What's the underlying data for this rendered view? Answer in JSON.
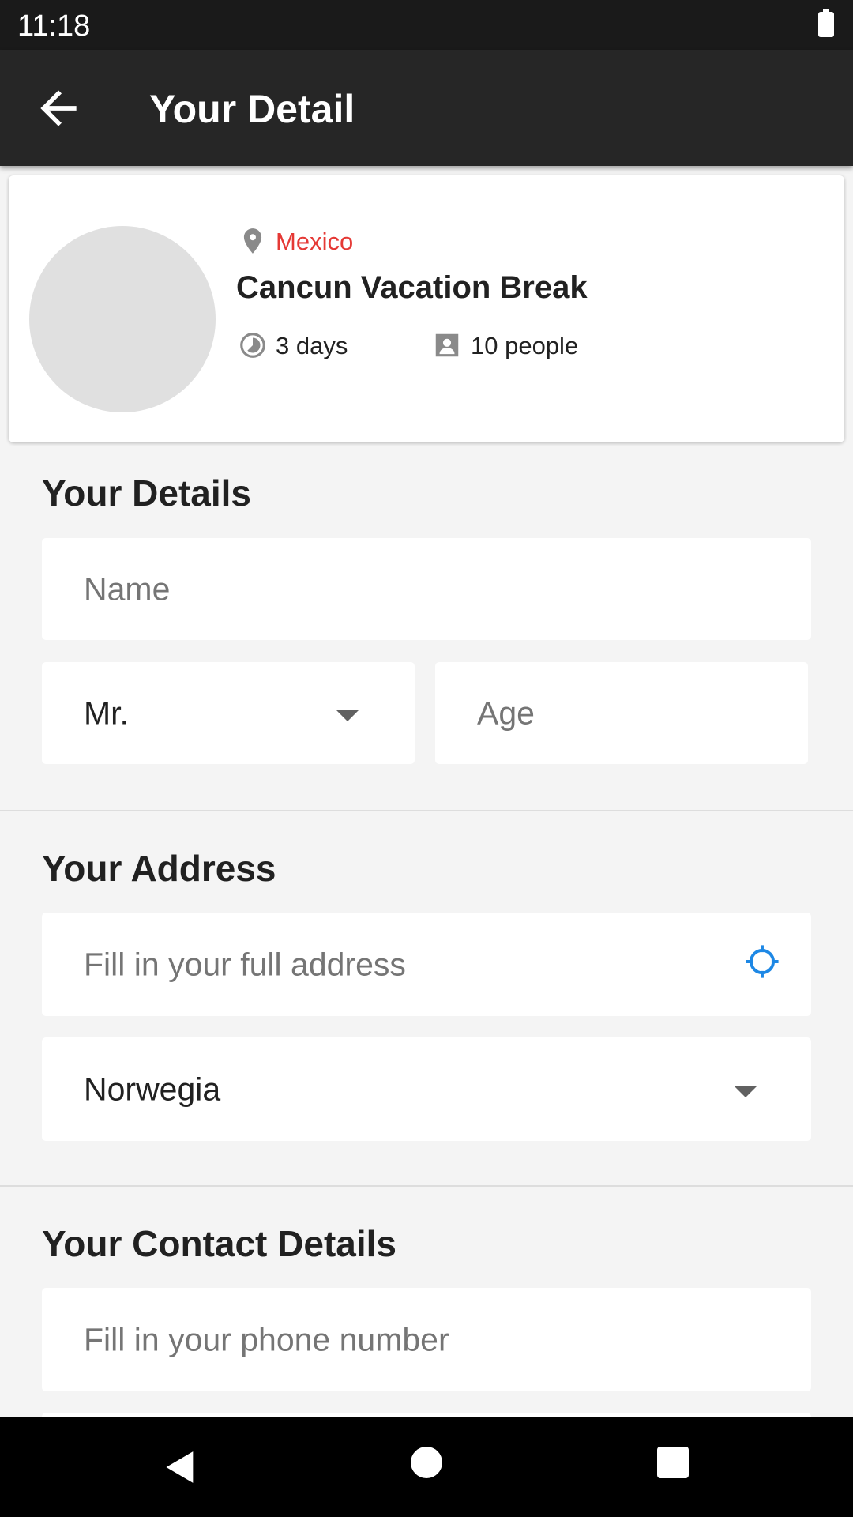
{
  "status_bar": {
    "time": "11:18"
  },
  "app_bar": {
    "title": "Your Detail"
  },
  "tour": {
    "location": "Mexico",
    "name": "Cancun Vacation Break",
    "duration": "3 days",
    "people": "10 people"
  },
  "details_section": {
    "title": "Your Details",
    "name_placeholder": "Name",
    "title_select_value": "Mr.",
    "age_placeholder": "Age"
  },
  "address_section": {
    "title": "Your Address",
    "address_placeholder": "Fill in your full address",
    "country_value": "Norwegia"
  },
  "contact_section": {
    "title": "Your Contact Details",
    "phone_placeholder": "Fill in your phone number"
  },
  "colors": {
    "accent_red": "#e53935",
    "gps_blue": "#1e88e5",
    "app_bar": "#262626"
  }
}
